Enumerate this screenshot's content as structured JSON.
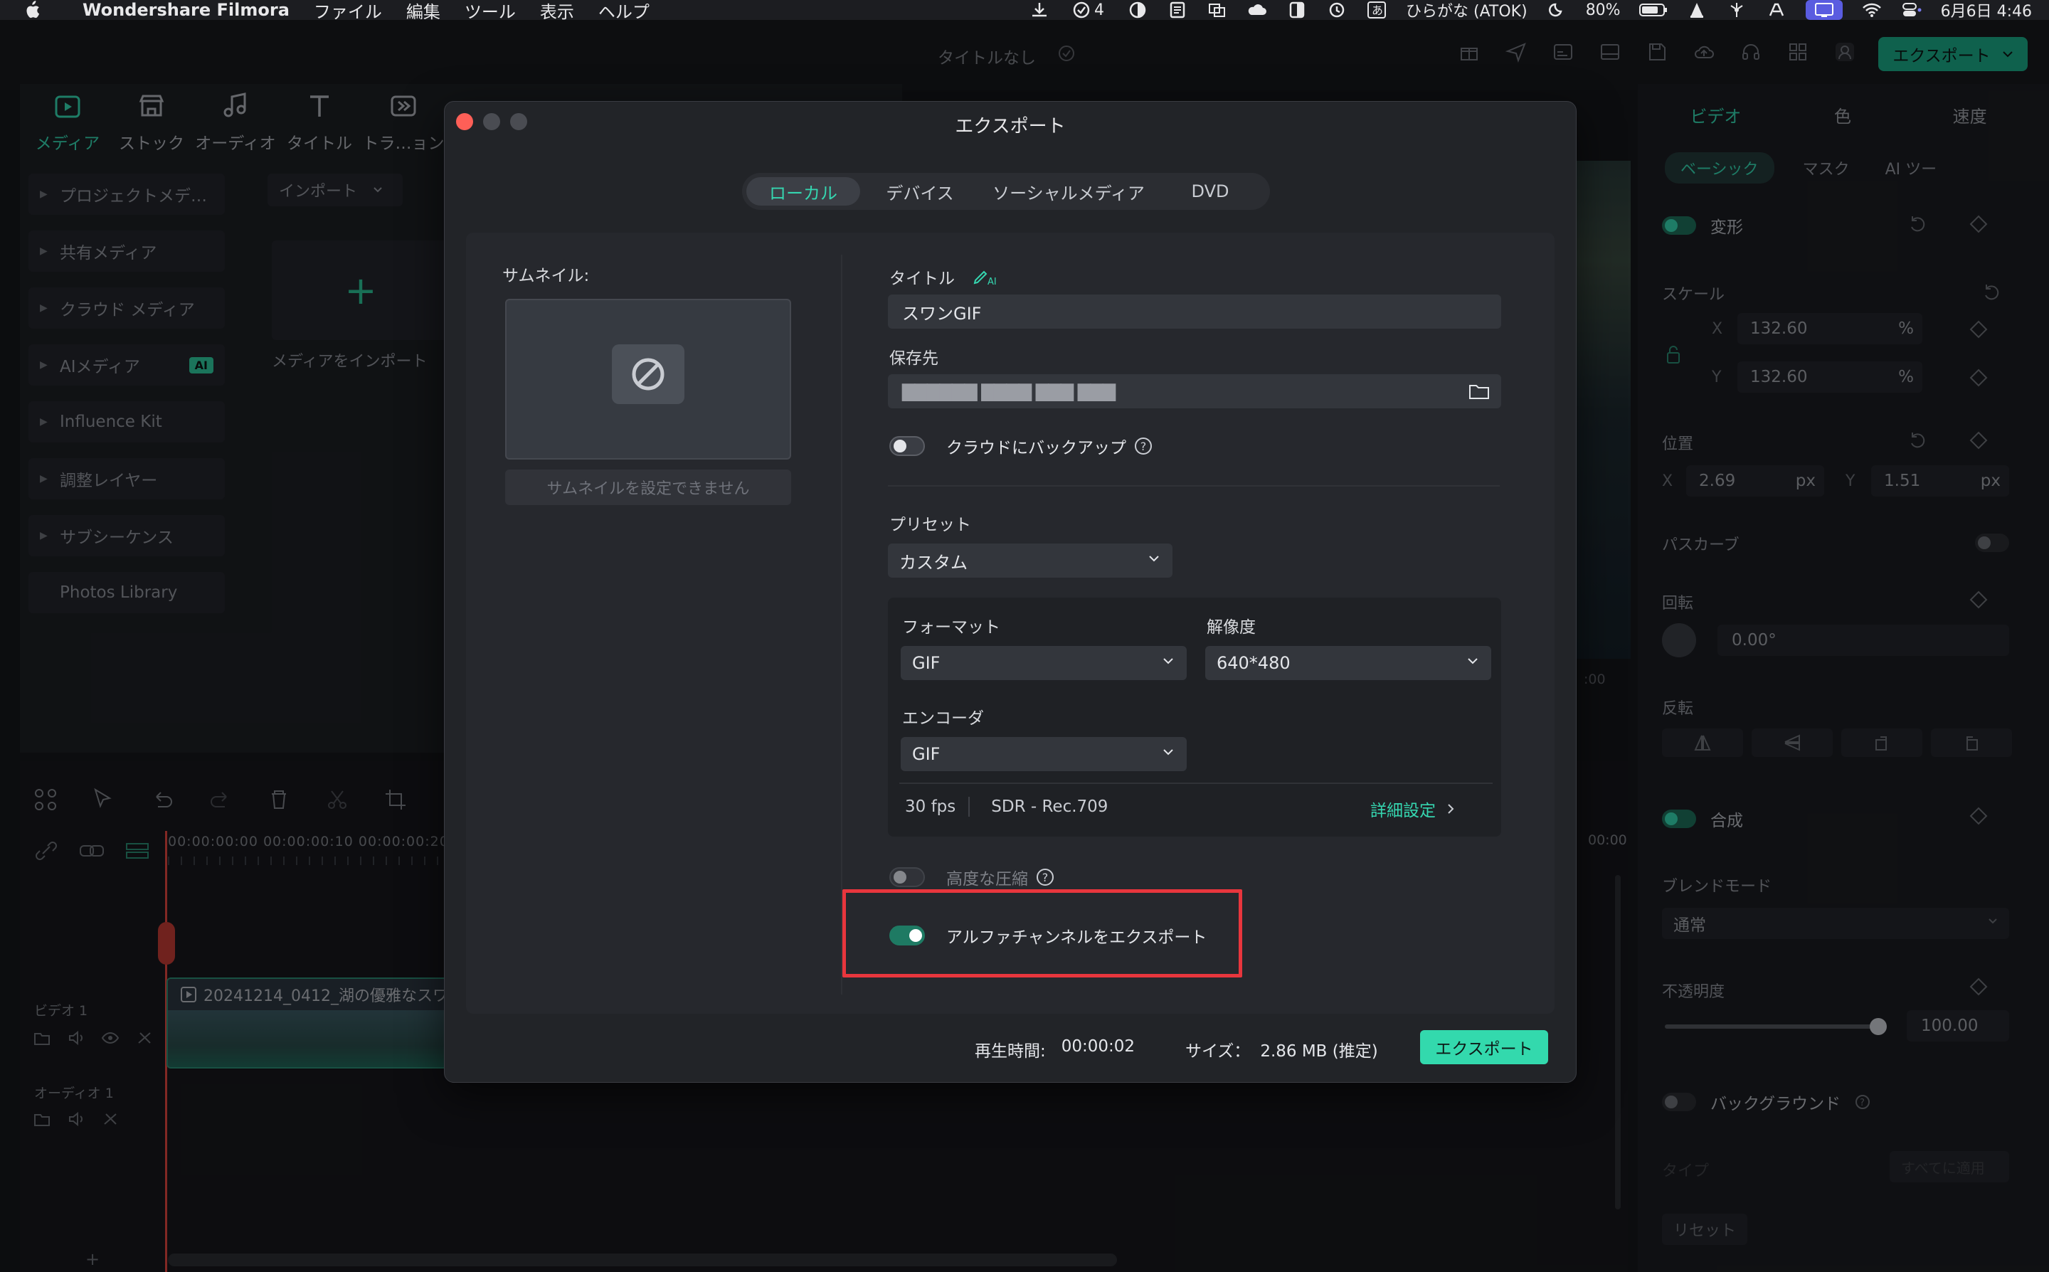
{
  "menubar": {
    "app_name": "Wondershare Filmora",
    "items": [
      "ファイル",
      "編集",
      "ツール",
      "表示",
      "ヘルプ"
    ],
    "badge_count": "4",
    "input_method": "ひらがな (ATOK)",
    "battery": "80%",
    "datetime": "6月6日 4:46"
  },
  "app": {
    "project_title": "タイトルなし",
    "export_label": "エクスポート"
  },
  "toptabs": [
    "メディア",
    "ストック",
    "オーディオ",
    "タイトル",
    "トラ…ョン"
  ],
  "media_sidebar": {
    "items": [
      "プロジェクトメデ…",
      "共有メディア",
      "クラウド メディア",
      "AIメディア",
      "Influence Kit",
      "調整レイヤー",
      "サブシーケンス",
      "Photos Library"
    ],
    "ai_badge": "AI"
  },
  "media": {
    "import_label": "インポート",
    "import_tile_label": "メディアをインポート"
  },
  "timeline": {
    "ruler": "00:00:00:00   00:00:00:10   00:00:00:20",
    "clip_title": "20241214_0412_湖の優雅なスワ",
    "track_video": "ビデオ 1",
    "track_audio": "オーディオ 1",
    "right_time": "00:00",
    "right_time2": ":00"
  },
  "inspector": {
    "tabs": [
      "ビデオ",
      "色",
      "速度"
    ],
    "subtabs": [
      "ベーシック",
      "マスク",
      "AI ツー"
    ],
    "transform": "変形",
    "scale": "スケール",
    "scale_x": "132.60",
    "scale_y": "132.60",
    "percent": "%",
    "x": "X",
    "y": "Y",
    "position": "位置",
    "pos_x": "2.69",
    "pos_y": "1.51",
    "px": "px",
    "path_curve": "パスカーブ",
    "rotate": "回転",
    "rotate_val": "0.00°",
    "flip": "反転",
    "compose": "合成",
    "blend_mode": "ブレンドモード",
    "blend_val": "通常",
    "opacity": "不透明度",
    "opacity_val": "100.00",
    "opacity_fraction": 1.0,
    "background": "バックグラウンド",
    "type": "タイプ",
    "apply_all": "すべてに適用",
    "reset": "リセット"
  },
  "dialog": {
    "title": "エクスポート",
    "tabs": [
      "ローカル",
      "デバイス",
      "ソーシャルメディア",
      "DVD"
    ],
    "thumbnail_label": "サムネイル:",
    "thumbnail_button": "サムネイルを設定できません",
    "title_label": "タイトル",
    "title_value": "スワンGIF",
    "save_to_label": "保存先",
    "save_to_value": "▇▇▇▇▇▇ ▇▇▇▇ ▇▇▇ ▇▇▇",
    "cloud_backup": "クラウドにバックアップ",
    "preset_label": "プリセット",
    "preset_value": "カスタム",
    "format_label": "フォーマット",
    "format_value": "GIF",
    "resolution_label": "解像度",
    "resolution_value": "640*480",
    "encoder_label": "エンコーダ",
    "encoder_value": "GIF",
    "fps": "30 fps",
    "color": "SDR - Rec.709",
    "advanced_settings": "詳細設定",
    "advanced_compression": "高度な圧縮",
    "alpha_export": "アルファチャンネルをエクスポート",
    "duration_label": "再生時間:",
    "duration_value": "00:00:02",
    "size_label": "サイズ：",
    "size_value": "2.86 MB (推定)",
    "export_button": "エクスポート",
    "cloud_backup_on": false,
    "advanced_compression_on": false,
    "alpha_export_on": true
  },
  "colors": {
    "accent": "#35d6b0",
    "highlight": "#e8363d",
    "export_button": "#33d9ad"
  }
}
